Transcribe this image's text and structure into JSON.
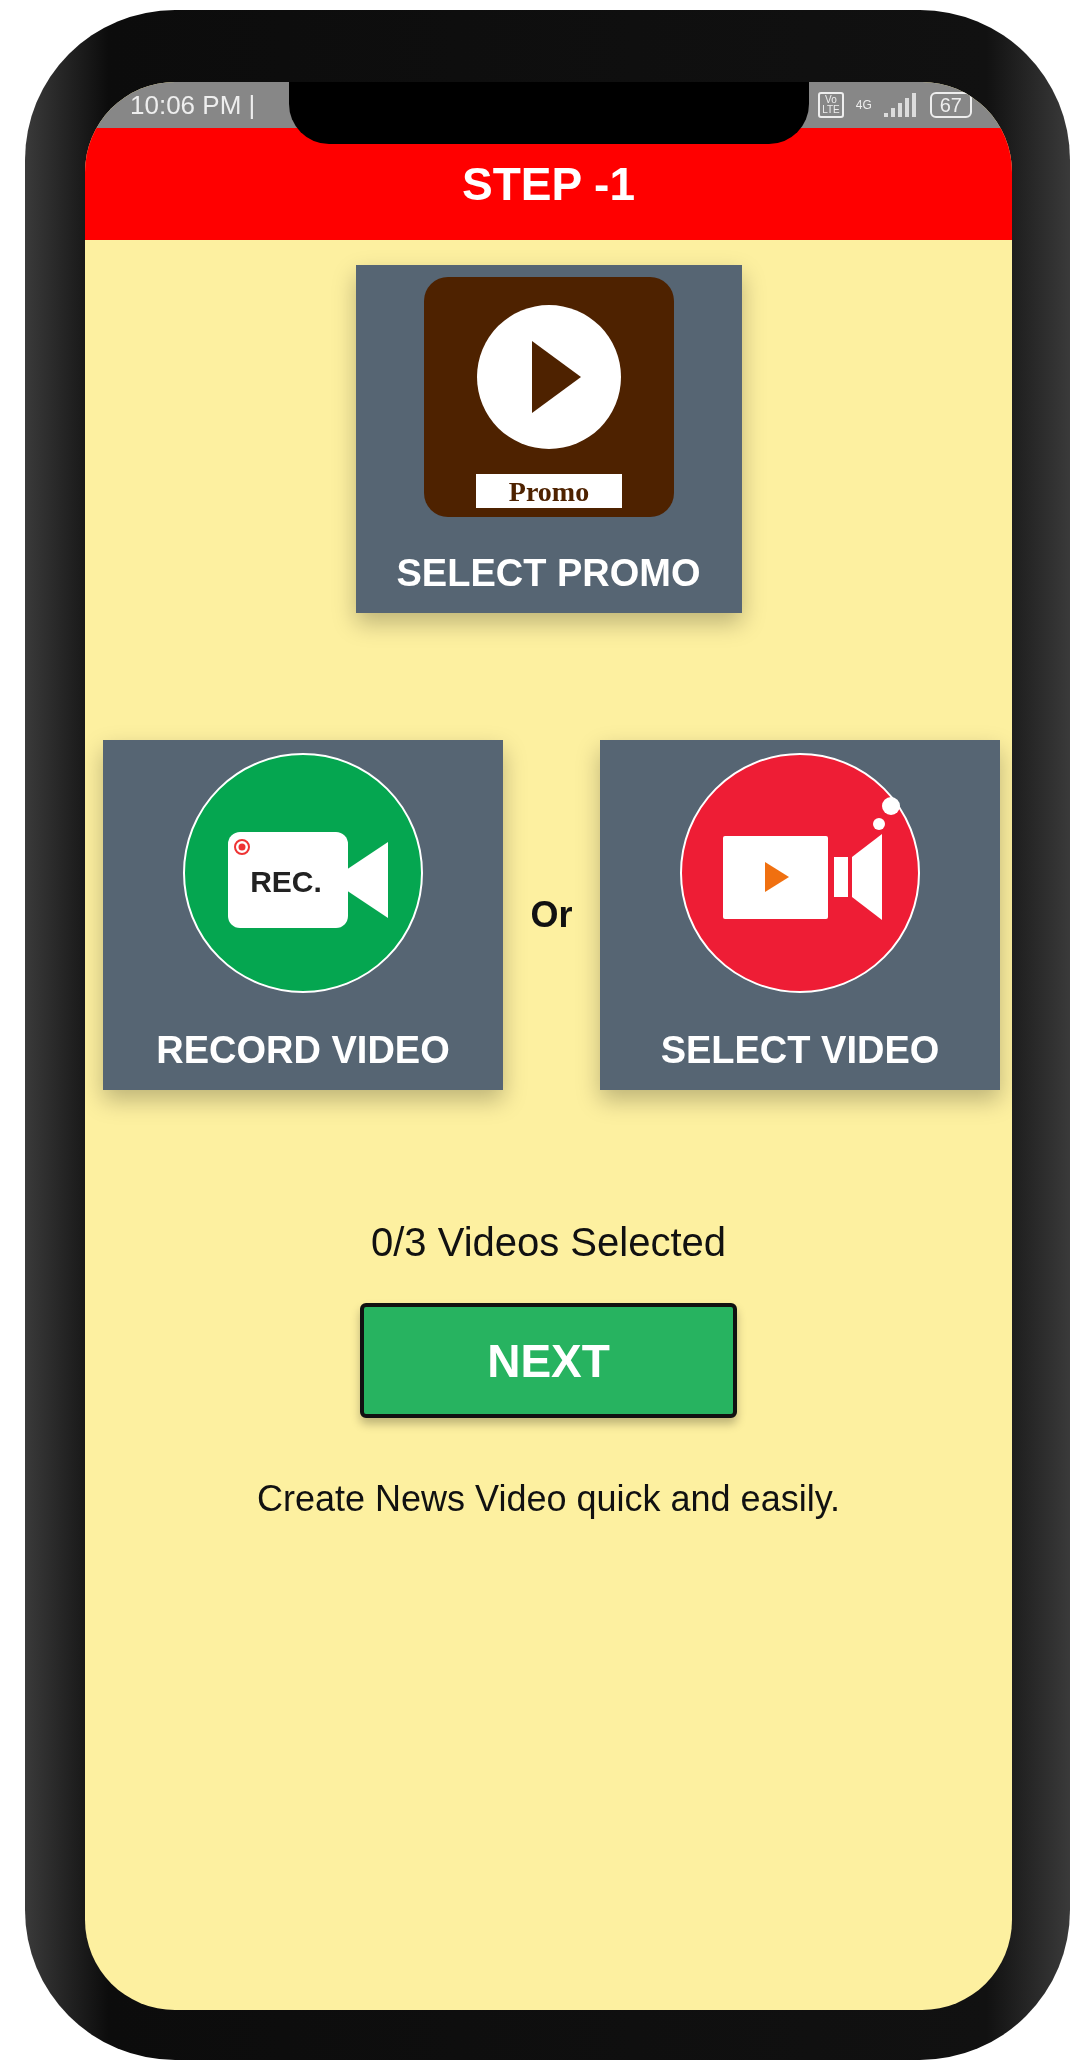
{
  "status_bar": {
    "time": "10:06 PM |",
    "volte": [
      "Vo",
      "LTE"
    ],
    "network": "4G",
    "battery": "67"
  },
  "header": {
    "title": "STEP -1"
  },
  "promo_card": {
    "icon_label": "Promo",
    "label": "SELECT PROMO"
  },
  "video_cards": [
    {
      "kind": "record",
      "icon_label": "REC.",
      "label": "RECORD VIDEO"
    },
    {
      "kind": "select",
      "label": "SELECT VIDEO"
    }
  ],
  "separator": "Or",
  "counter": "0/3 Videos Selected",
  "next_button": "NEXT",
  "caption": "Create News Video quick and easily."
}
